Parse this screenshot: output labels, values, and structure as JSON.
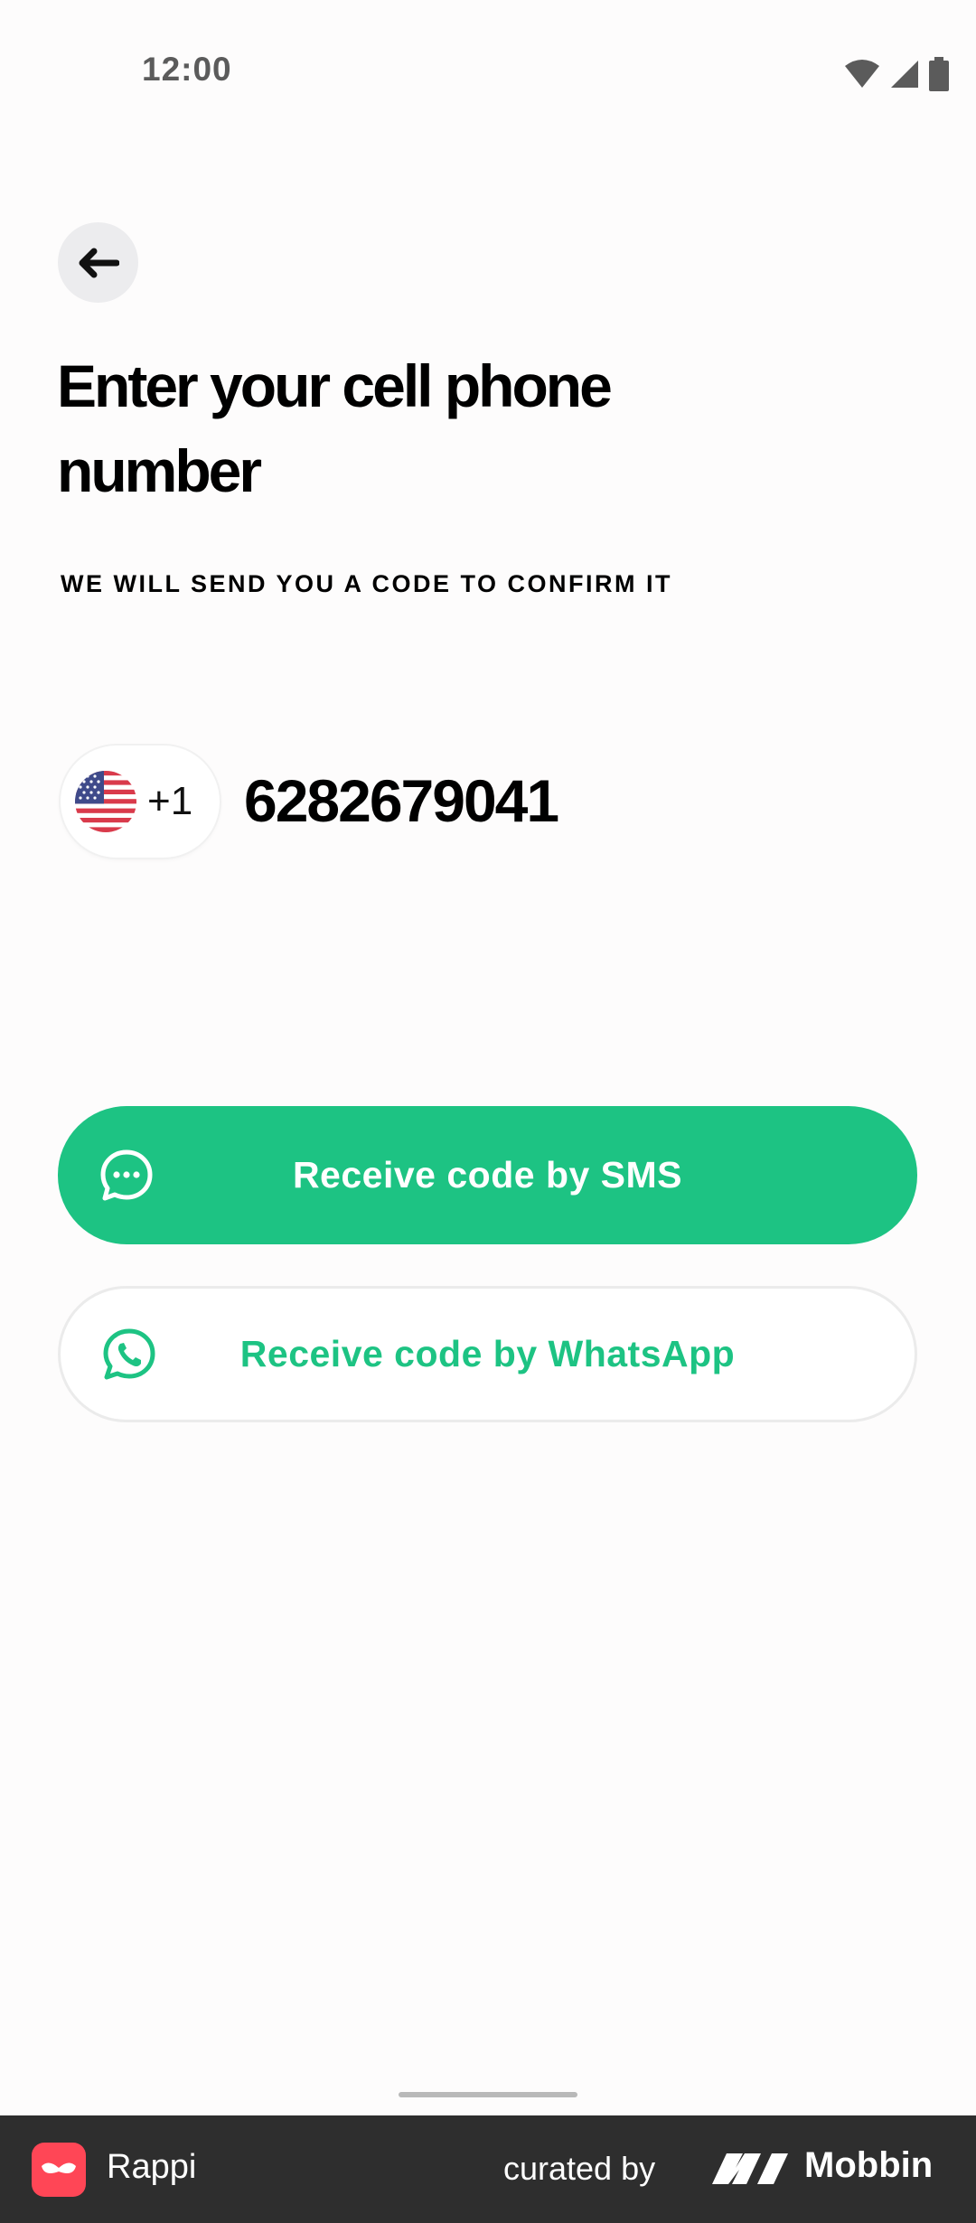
{
  "status_bar": {
    "time": "12:00",
    "icons": [
      "wifi-icon",
      "signal-icon",
      "battery-icon"
    ]
  },
  "header": {
    "back_icon": "arrow-left-icon",
    "title": "Enter your cell phone number",
    "subtitle": "WE WILL SEND YOU A CODE TO CONFIRM IT"
  },
  "phone": {
    "country_flag": "us-flag-icon",
    "dial_code": "+1",
    "number": "6282679041"
  },
  "actions": {
    "sms_label": "Receive code by SMS",
    "sms_icon": "chat-bubble-icon",
    "whatsapp_label": "Receive code by WhatsApp",
    "whatsapp_icon": "whatsapp-icon"
  },
  "footer": {
    "app_name": "Rappi",
    "curated_by": "curated by",
    "brand": "Mobbin"
  },
  "colors": {
    "accent": "#1DC383",
    "background": "#FDFCFC",
    "footer": "#2E2E2E",
    "rappi": "#FF4656"
  }
}
